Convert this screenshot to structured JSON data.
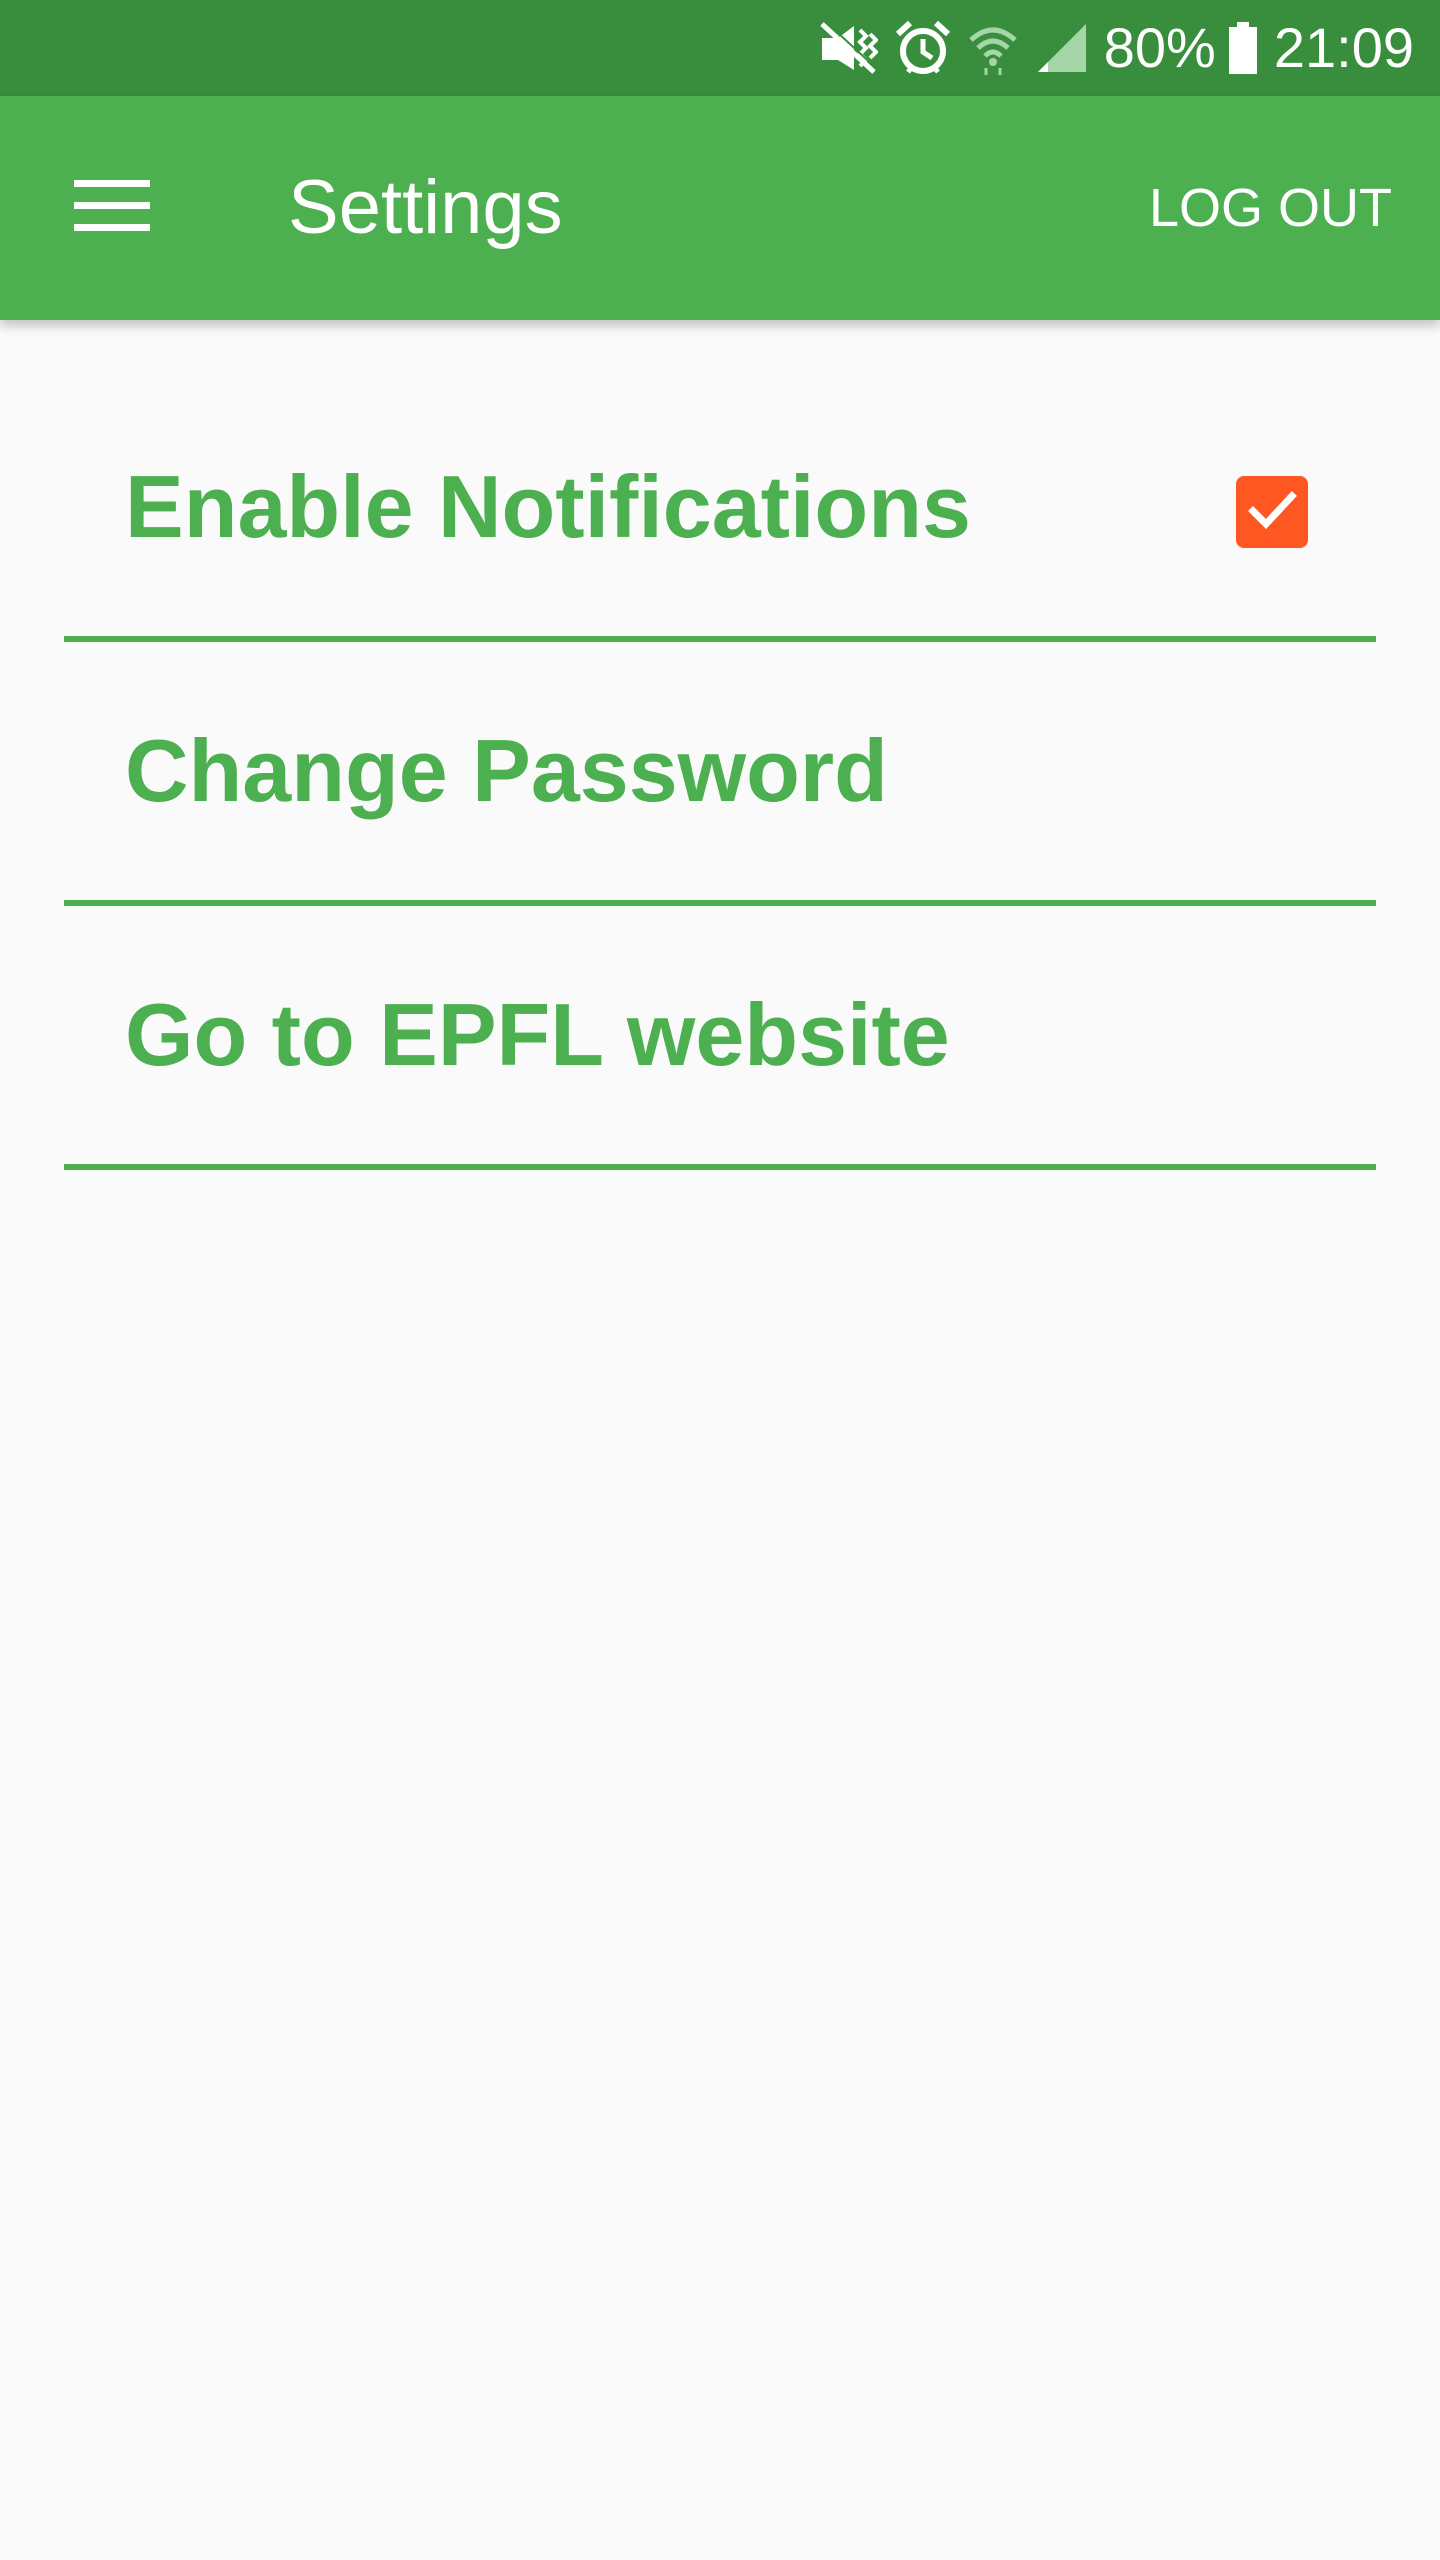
{
  "status_bar": {
    "battery_text": "80%",
    "time": "21:09",
    "icons": [
      "vibrate-icon",
      "alarm-icon",
      "wifi-icon",
      "signal-icon",
      "battery-icon"
    ]
  },
  "app_bar": {
    "menu_icon": "hamburger-menu-icon",
    "title": "Settings",
    "logout_label": "LOG OUT"
  },
  "settings": {
    "items": [
      {
        "label": "Enable Notifications",
        "checkbox_checked": true
      },
      {
        "label": "Change Password"
      },
      {
        "label": "Go to EPFL website"
      }
    ]
  },
  "colors": {
    "status_bar": "#388e3c",
    "app_bar": "#4caf50",
    "accent": "#4caf50",
    "checkbox": "#ff5722",
    "background": "#fafafa"
  }
}
